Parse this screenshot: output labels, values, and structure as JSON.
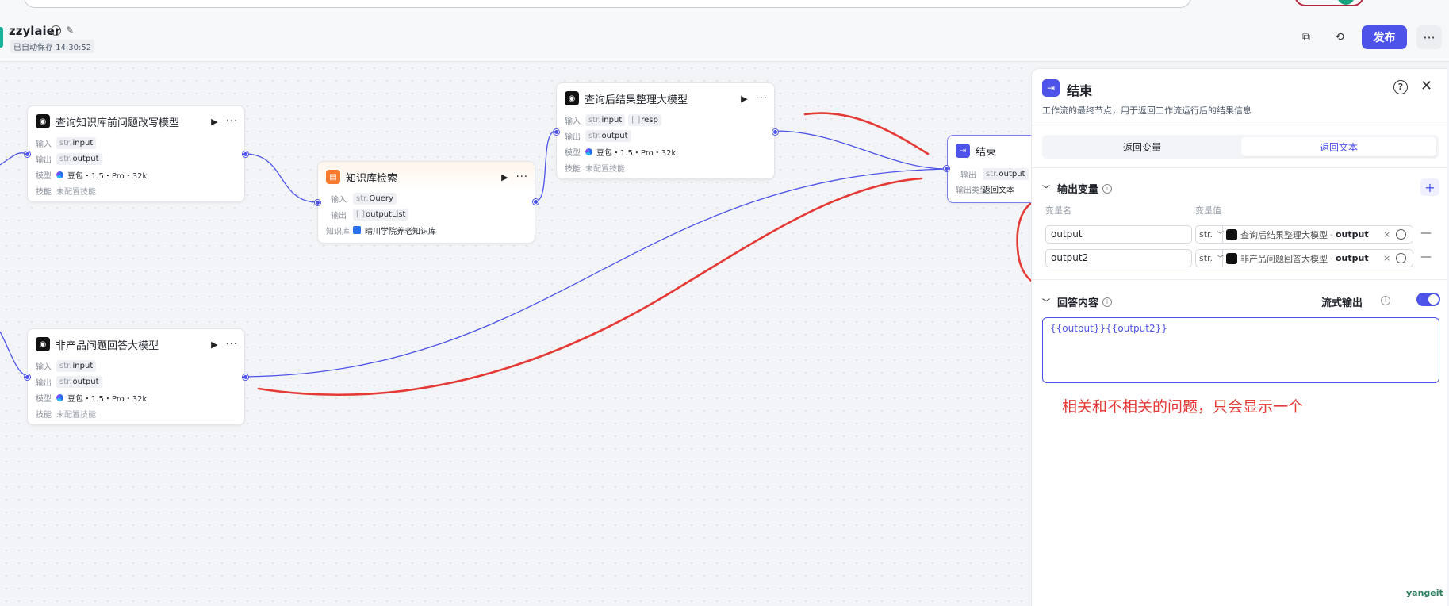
{
  "header": {
    "app_name": "zzylaier",
    "autosave": "已自动保存 14:30:52",
    "publish_label": "发布",
    "more_label": "···"
  },
  "nodes": [
    {
      "id": "rewrite",
      "title": "查询知识库前问题改写模型",
      "input_label": "输入",
      "input_type": "str.",
      "input_value": "input",
      "output_label": "输出",
      "output_type": "str.",
      "output_value": "output",
      "model_label": "模型",
      "model_value": "豆包・1.5・Pro・32k",
      "skill_label": "技能",
      "skill_value": "未配置技能"
    },
    {
      "id": "kb",
      "title": "知识库检索",
      "input_label": "输入",
      "input_type": "str.",
      "input_value": "Query",
      "output_label": "输出",
      "output_type": "[ ]",
      "output_value": "outputList",
      "kb_label": "知识库",
      "kb_value": "晴川学院养老知识库"
    },
    {
      "id": "summary",
      "title": "查询后结果整理大模型",
      "input_label": "输入",
      "input_type": "str.",
      "input_value": "input",
      "input2_type": "[ ]",
      "input2_value": "resp",
      "output_label": "输出",
      "output_type": "str.",
      "output_value": "output",
      "model_label": "模型",
      "model_value": "豆包・1.5・Pro・32k",
      "skill_label": "技能",
      "skill_value": "未配置技能"
    },
    {
      "id": "nonproduct",
      "title": "非产品问题回答大模型",
      "input_label": "输入",
      "input_type": "str.",
      "input_value": "input",
      "output_label": "输出",
      "output_type": "str.",
      "output_value": "output",
      "model_label": "模型",
      "model_value": "豆包・1.5・Pro・32k",
      "skill_label": "技能",
      "skill_value": "未配置技能"
    },
    {
      "id": "end",
      "title": "结束",
      "output_label": "输出",
      "output_type": "str.",
      "output_value": "output",
      "output_kind_label": "输出类型",
      "output_kind_value": "返回文本"
    }
  ],
  "panel": {
    "title": "结束",
    "description": "工作流的最终节点，用于返回工作流运行后的结果信息",
    "tabs": [
      {
        "label": "返回变量",
        "active": false
      },
      {
        "label": "返回文本",
        "active": true
      }
    ],
    "output_section_title": "输出变量",
    "col_name": "变量名",
    "col_value": "变量值",
    "variables": [
      {
        "name": "output",
        "type": "str.",
        "ref_node": "查询后结果整理大模型",
        "ref_sep": "-",
        "ref_field": "output"
      },
      {
        "name": "output2",
        "type": "str.",
        "ref_node": "非产品问题回答大模型",
        "ref_sep": "-",
        "ref_field": "output"
      }
    ],
    "answer_section_title": "回答内容",
    "stream_label": "流式输出",
    "stream_on": true,
    "answer_template": "{{output}}{{output2}}"
  },
  "annotation": "相关和不相关的问题，只会显示一个",
  "watermark": "yangeit",
  "colors": {
    "accent": "#4d53e8",
    "annotation_red": "#e53935",
    "kb_orange": "#f77a2c"
  }
}
